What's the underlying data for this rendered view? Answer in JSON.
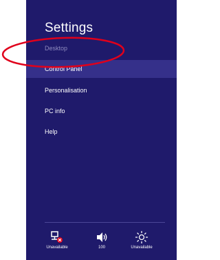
{
  "settings": {
    "title": "Settings",
    "items": [
      {
        "label": "Desktop",
        "disabled": true
      },
      {
        "label": "Control Panel",
        "highlighted": true
      },
      {
        "label": "Personalisation"
      },
      {
        "label": "PC info"
      },
      {
        "label": "Help"
      }
    ]
  },
  "system_tray": [
    {
      "icon": "network-unavailable-icon",
      "label": "Unavailable"
    },
    {
      "icon": "volume-icon",
      "label": "100"
    },
    {
      "icon": "brightness-icon",
      "label": "Unavailable"
    }
  ],
  "annotation": {
    "shape": "ellipse",
    "color": "#e0001b"
  }
}
